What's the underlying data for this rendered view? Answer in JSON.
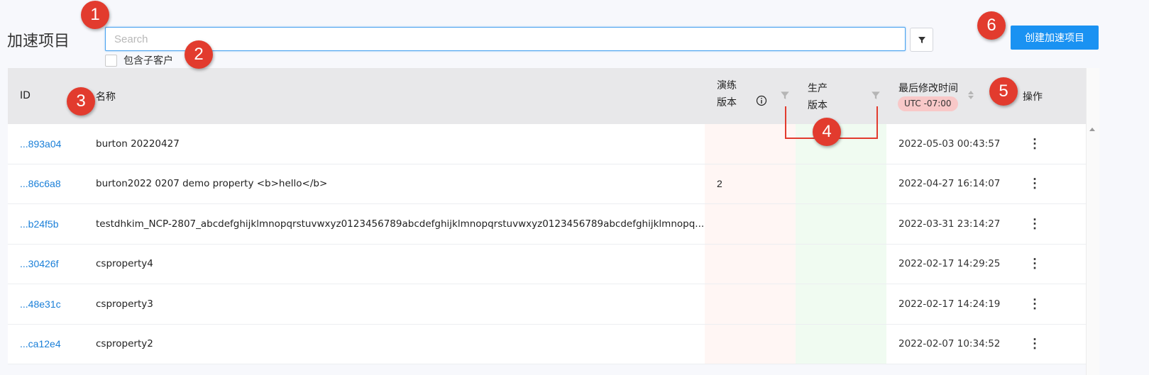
{
  "header": {
    "title": "加速项目",
    "search_placeholder": "Search",
    "include_subcustomers_label": "包含子客户",
    "create_button_label": "创建加速项目"
  },
  "table": {
    "columns": {
      "id": "ID",
      "name": "名称",
      "staging_line1": "演练",
      "staging_line2": "版本",
      "production_line1": "生产",
      "production_line2": "版本",
      "last_modified": "最后修改时间",
      "timezone_badge": "UTC -07:00",
      "actions": "操作"
    },
    "rows": [
      {
        "id": "...893a04",
        "name": "burton 20220427",
        "staging": "",
        "production": "",
        "modified": "2022-05-03 00:43:57"
      },
      {
        "id": "...86c6a8",
        "name": "burton2022 0207 demo property <b>hello</b>",
        "staging": "2",
        "production": "",
        "modified": "2022-04-27 16:14:07"
      },
      {
        "id": "...b24f5b",
        "name": "testdhkim_NCP-2807_abcdefghijklmnopqrstuvwxyz0123456789abcdefghijklmnopqrstuvwxyz0123456789abcdefghijklmnopq...",
        "staging": "",
        "production": "",
        "modified": "2022-03-31 23:14:27"
      },
      {
        "id": "...30426f",
        "name": "csproperty4",
        "staging": "",
        "production": "",
        "modified": "2022-02-17 14:29:25"
      },
      {
        "id": "...48e31c",
        "name": "csproperty3",
        "staging": "",
        "production": "",
        "modified": "2022-02-17 14:24:19"
      },
      {
        "id": "...ca12e4",
        "name": "csproperty2",
        "staging": "",
        "production": "",
        "modified": "2022-02-07 10:34:52"
      }
    ],
    "row_action_icon": "⋮"
  },
  "annotations": [
    "1",
    "2",
    "3",
    "4",
    "5",
    "6"
  ],
  "colors": {
    "accent": "#1a92f2",
    "link": "#1a7fd8",
    "marker": "#e23b2e",
    "staging_bg": "#fff6f4",
    "production_bg": "#f0fbf1",
    "badge_bg": "#f8c8c8"
  }
}
